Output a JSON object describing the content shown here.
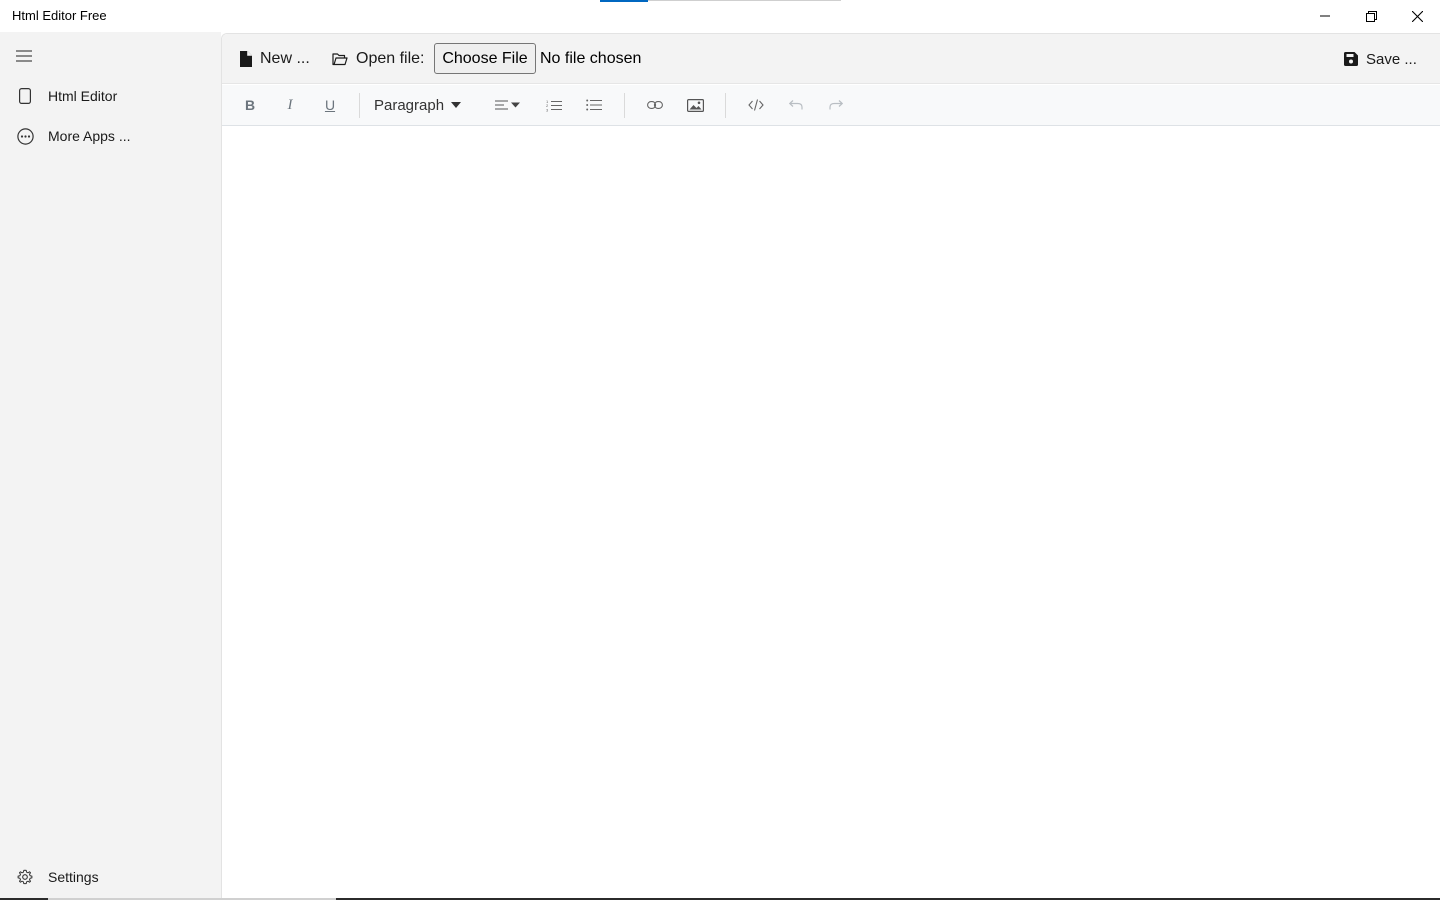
{
  "window": {
    "title": "Html Editor Free",
    "accent_color": "#0067c0",
    "controls": {
      "minimize_icon": "minimize-icon",
      "maximize_icon": "restore-icon",
      "close_icon": "close-icon"
    }
  },
  "sidebar": {
    "menu_icon": "hamburger-icon",
    "items": [
      {
        "label": "Html Editor",
        "icon": "page-icon"
      },
      {
        "label": "More Apps ...",
        "icon": "more-circle-icon"
      }
    ],
    "footer": {
      "label": "Settings",
      "icon": "gear-icon"
    }
  },
  "file_toolbar": {
    "new_label": "New ...",
    "open_label": "Open file:",
    "choose_file_label": "Choose File",
    "no_file_text": "No file chosen",
    "save_label": "Save ..."
  },
  "format_toolbar": {
    "bold_label": "B",
    "italic_label": "I",
    "underline_label": "U",
    "block_format": "Paragraph",
    "icons": [
      "align-icon",
      "ordered-list-icon",
      "bullet-list-icon",
      "link-icon",
      "image-icon",
      "code-icon",
      "undo-icon",
      "redo-icon"
    ]
  },
  "editor": {
    "content": ""
  }
}
